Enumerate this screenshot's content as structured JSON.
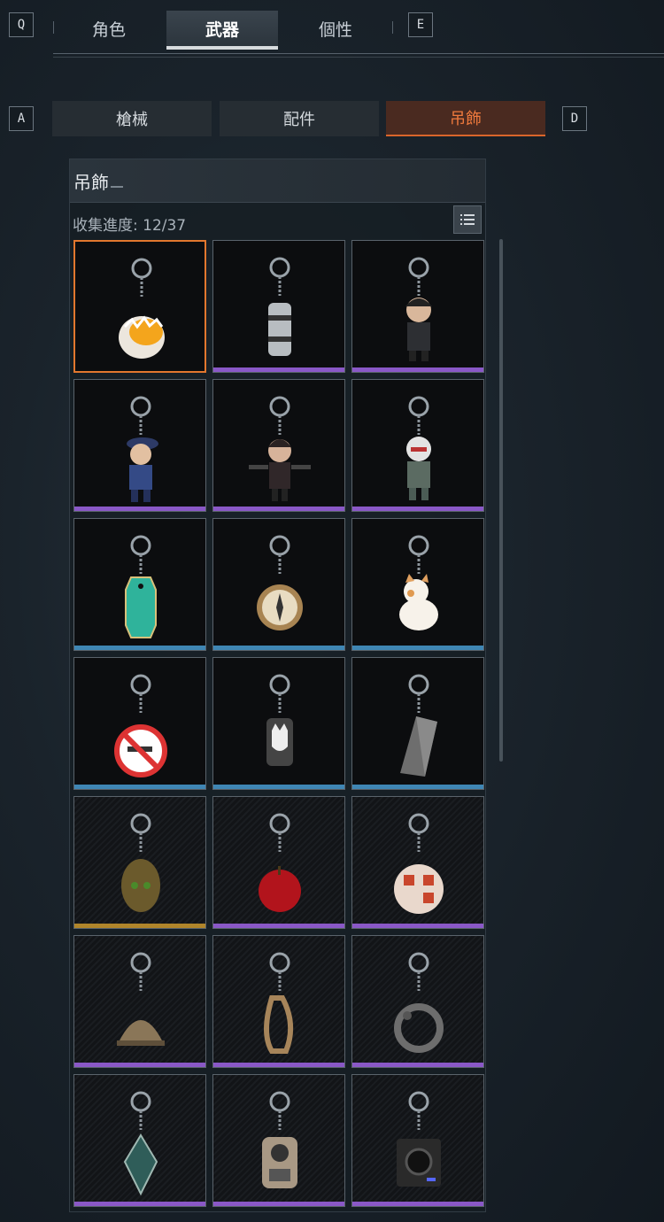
{
  "top_nav": {
    "left_key": "Q",
    "right_key": "E",
    "tabs": [
      {
        "label": "角色",
        "active": false
      },
      {
        "label": "武器",
        "active": true
      },
      {
        "label": "個性",
        "active": false
      }
    ]
  },
  "sub_nav": {
    "left_key": "A",
    "right_key": "D",
    "tabs": [
      {
        "label": "槍械",
        "active": false
      },
      {
        "label": "配件",
        "active": false
      },
      {
        "label": "吊飾",
        "active": true
      }
    ]
  },
  "panel": {
    "title": "吊飾",
    "progress_label": "收集進度: 12/37",
    "list_icon": "list-icon"
  },
  "colors": {
    "accent": "#e2772e",
    "rarity_purple": "#8a58c7",
    "rarity_blue": "#3f86b4",
    "rarity_gold": "#b0852a"
  },
  "items": [
    {
      "icon": "egg-charm-icon",
      "rarity": "purple",
      "selected": true,
      "owned": true
    },
    {
      "icon": "tech-cylinder-charm-icon",
      "rarity": "purple",
      "owned": true
    },
    {
      "icon": "chibi-suited-figure-charm-icon",
      "rarity": "purple",
      "owned": true
    },
    {
      "icon": "chibi-police-figure-charm-icon",
      "rarity": "purple",
      "owned": true
    },
    {
      "icon": "chibi-dual-pistol-figure-charm-icon",
      "rarity": "purple",
      "owned": true
    },
    {
      "icon": "chibi-masked-figure-charm-icon",
      "rarity": "purple",
      "owned": true
    },
    {
      "icon": "hotel-key-tag-charm-icon",
      "rarity": "blue",
      "owned": true
    },
    {
      "icon": "compass-charm-icon",
      "rarity": "blue",
      "owned": true
    },
    {
      "icon": "cat-charm-icon",
      "rarity": "blue",
      "owned": true
    },
    {
      "icon": "no-guns-sign-charm-icon",
      "rarity": "blue",
      "owned": true
    },
    {
      "icon": "husky-tag-charm-icon",
      "rarity": "blue",
      "owned": true
    },
    {
      "icon": "stone-shard-charm-icon",
      "rarity": "blue",
      "owned": true
    },
    {
      "icon": "ghillie-head-charm-icon",
      "rarity": "gold",
      "owned": false
    },
    {
      "icon": "apple-charm-icon",
      "rarity": "purple",
      "owned": false
    },
    {
      "icon": "die-ball-charm-icon",
      "rarity": "purple",
      "owned": false
    },
    {
      "icon": "camo-helmet-charm-icon",
      "rarity": "purple",
      "owned": false
    },
    {
      "icon": "carabiner-charm-icon",
      "rarity": "purple",
      "owned": false
    },
    {
      "icon": "serpent-ring-charm-icon",
      "rarity": "purple",
      "owned": false
    },
    {
      "icon": "crystal-charm-icon",
      "rarity": "purple",
      "owned": false
    },
    {
      "icon": "gadget-device-charm-icon",
      "rarity": "purple",
      "owned": false
    },
    {
      "icon": "camera-box-charm-icon",
      "rarity": "purple",
      "owned": false
    }
  ]
}
